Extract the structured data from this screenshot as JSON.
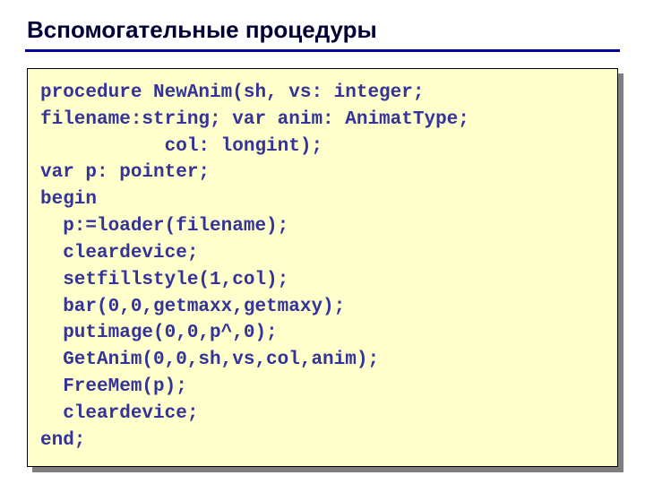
{
  "title": "Вспомогательные процедуры",
  "code": "procedure NewAnim(sh, vs: integer;\nfilename:string; var anim: AnimatType;\n           col: longint);\nvar p: pointer;\nbegin\n  p:=loader(filename);\n  cleardevice;\n  setfillstyle(1,col);\n  bar(0,0,getmaxx,getmaxy);\n  putimage(0,0,p^,0);\n  GetAnim(0,0,sh,vs,col,anim);\n  FreeMem(p);\n  cleardevice;\nend;"
}
